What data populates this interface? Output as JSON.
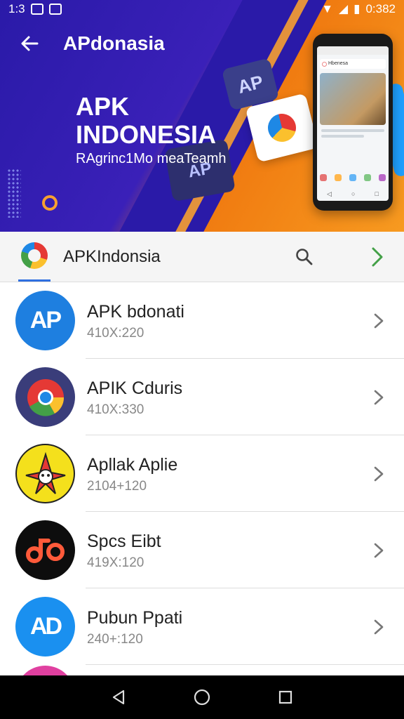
{
  "status_bar": {
    "time": "1:3",
    "right_text": "0:382"
  },
  "app_bar": {
    "title": "APdonasia"
  },
  "hero": {
    "title_line1": "APK",
    "title_line2": "INDONESIA",
    "subtitle": "RAgrinc1Mo meaTeamh",
    "tile_label_1": "AP",
    "tile_label_2": "AP",
    "phone_search_text": "Hbenesa"
  },
  "search_row": {
    "label": "APKIndonsia"
  },
  "list": {
    "items": [
      {
        "title": "APK bdonati",
        "subtitle": "410X:220",
        "avatar_text": "AP"
      },
      {
        "title": "APIK Cduris",
        "subtitle": "410X:330",
        "avatar_text": ""
      },
      {
        "title": "Apllak Aplie",
        "subtitle": "2104+120",
        "avatar_text": ""
      },
      {
        "title": "Spcs Eibt",
        "subtitle": "419X:120",
        "avatar_text": ""
      },
      {
        "title": "Pubun Ppati",
        "subtitle": "240+:120",
        "avatar_text": "AD"
      }
    ]
  },
  "colors": {
    "hero_blue": "#2a1aa8",
    "hero_orange": "#f07a10",
    "accent": "#2f6fe0",
    "chevron_green": "#43a047"
  },
  "icons": {
    "back": "arrow-left-icon",
    "search": "search-icon",
    "chevron": "chevron-right-icon",
    "nav_back": "triangle-back-icon",
    "nav_home": "circle-home-icon",
    "nav_recents": "square-recents-icon"
  }
}
